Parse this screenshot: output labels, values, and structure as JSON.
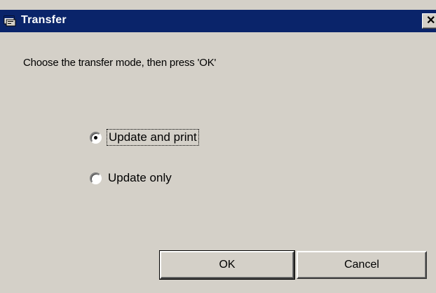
{
  "window": {
    "title": "Transfer",
    "close_symbol": "✕",
    "title_icon": "dialog-app-icon",
    "colors": {
      "titlebar": "#0a246a",
      "face": "#d4d0c8",
      "title_text": "#ffffff"
    }
  },
  "prompt": "Choose the transfer mode, then press 'OK'",
  "options": [
    {
      "label": "Update and print",
      "selected": true,
      "focused": true
    },
    {
      "label": "Update only",
      "selected": false,
      "focused": false
    }
  ],
  "buttons": {
    "ok_label": "OK",
    "cancel_label": "Cancel"
  }
}
